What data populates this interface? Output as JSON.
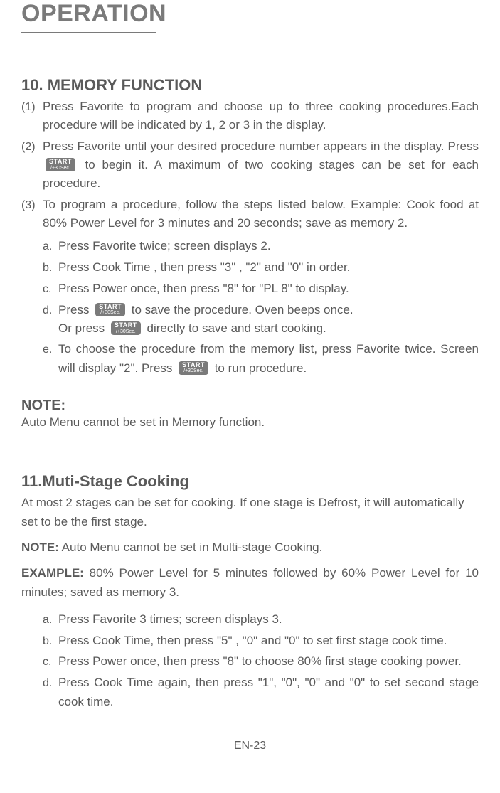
{
  "title": "OPERATION",
  "section10": {
    "heading": "10. MEMORY FUNCTION",
    "items": [
      {
        "marker": "(1)",
        "text": "Press Favorite to program and choose up to three cooking procedures.Each procedure will be indicated by 1, 2 or 3 in the display."
      },
      {
        "marker": "(2)",
        "pre": "Press  Favorite until your desired procedure number appears in the display. Press  ",
        "post": "  to begin it. A maximum of two cooking stages can be set for each procedure."
      },
      {
        "marker": "(3)",
        "text": "To program a procedure, follow the steps listed below. Example: Cook food at 80%  Power Level for 3 minutes and 20 seconds; save as memory 2."
      }
    ],
    "sub": {
      "a": {
        "marker": "a.",
        "text": "Press Favorite twice; screen displays 2."
      },
      "b": {
        "marker": "b.",
        "text": "Press Cook Time , then press \"3\" , \"2\" and \"0\" in order."
      },
      "c": {
        "marker": "c.",
        "text": "Press Power  once, then press \"8\" for \"PL 8\" to display."
      },
      "d": {
        "marker": "d.",
        "pre1": "Press ",
        "mid1": "   to save the procedure. Oven beeps once.",
        "pre2": "Or press ",
        "mid2": "   directly to save and start cooking."
      },
      "e": {
        "marker": "e.",
        "pre": "To choose the procedure from the memory list, press  Favorite  twice. Screen will display \"2\".  Press    ",
        "post": "    to run procedure."
      }
    }
  },
  "note1": {
    "heading": "NOTE:",
    "body": "Auto Menu cannot be set in Memory function."
  },
  "section11": {
    "heading": "11.Muti-Stage Cooking",
    "intro": "At most 2 stages can be set for cooking. If one stage is Defrost, it will automatically set to  be the first stage.",
    "note_label": "NOTE:",
    "note_text": " Auto Menu cannot be set in Multi-stage Cooking.",
    "example_label": "EXAMPLE:",
    "example_text": " 80% Power Level for 5 minutes followed by 60% Power Level for 10 minutes;  saved as memory 3.",
    "steps": {
      "a": {
        "marker": "a.",
        "text": "Press Favorite 3 times; screen displays 3."
      },
      "b": {
        "marker": "b.",
        "text": "Press Cook Time, then press \"5\" , \"0\" and \"0\" to set first stage cook time."
      },
      "c": {
        "marker": "c.",
        "text": "Press Power once, then press \"8\" to choose 80% first stage cooking power."
      },
      "d": {
        "marker": "d.",
        "text": "Press Cook Time again, then press \"1\", \"0\", \"0\" and \"0\" to set second stage cook time."
      }
    }
  },
  "start_button": {
    "line1": "START",
    "line2": "/+30Sec."
  },
  "footer": "EN-23"
}
